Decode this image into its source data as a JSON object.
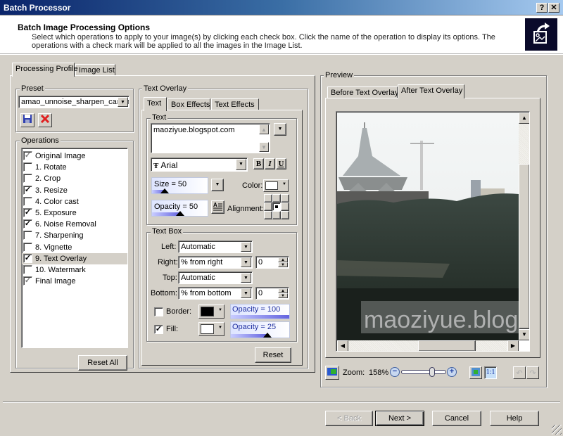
{
  "window": {
    "title": "Batch Processor",
    "help_button": "?",
    "close_button": "✕"
  },
  "header": {
    "title": "Batch Image Processing Options",
    "description": "Select which operations to apply to your image(s) by clicking each check box.  Click the name of the operation to display its options.  The operations with a check mark will be applied to all the images in the Image List."
  },
  "left_tabs": [
    {
      "label": "Processing Profile",
      "active": true
    },
    {
      "label": "Image List",
      "active": false
    }
  ],
  "preset": {
    "group_label": "Preset",
    "selected": "amao_unnoise_sharpen_canon"
  },
  "operations": {
    "group_label": "Operations",
    "items": [
      {
        "label": "Original Image",
        "checked": true,
        "locked": true
      },
      {
        "label": "1. Rotate",
        "checked": false
      },
      {
        "label": "2. Crop",
        "checked": false
      },
      {
        "label": "3. Resize",
        "checked": true
      },
      {
        "label": "4. Color cast",
        "checked": false
      },
      {
        "label": "5. Exposure",
        "checked": true
      },
      {
        "label": "6. Noise Removal",
        "checked": true
      },
      {
        "label": "7. Sharpening",
        "checked": false
      },
      {
        "label": "8. Vignette",
        "checked": false
      },
      {
        "label": "9. Text Overlay",
        "checked": true,
        "selected": true
      },
      {
        "label": "10. Watermark",
        "checked": false
      },
      {
        "label": "Final Image",
        "checked": true,
        "locked": true
      }
    ],
    "reset_all_label": "Reset All"
  },
  "text_overlay": {
    "group_label": "Text Overlay",
    "tabs": [
      {
        "label": "Text",
        "active": true
      },
      {
        "label": "Box Effects",
        "active": false
      },
      {
        "label": "Text Effects",
        "active": false
      }
    ],
    "text_group_label": "Text",
    "text_value": "maoziyue.blogspot.com",
    "font": "Arial",
    "bold_label": "B",
    "italic_label": "I",
    "underline_label": "U",
    "size_label": "Size = 50",
    "size_value": 50,
    "opacity_label": "Opacity = 50",
    "opacity_value": 50,
    "color_label": "Color:",
    "color_value": "#ffffff",
    "alignment_label": "Alignment:",
    "alignment_selected": "center",
    "text_box": {
      "group_label": "Text Box",
      "left_label": "Left:",
      "left_value": "Automatic",
      "right_label": "Right:",
      "right_value": "% from right",
      "right_number": "0",
      "top_label": "Top:",
      "top_value": "Automatic",
      "bottom_label": "Bottom:",
      "bottom_value": "% from bottom",
      "bottom_number": "0",
      "border_label": "Border:",
      "border_checked": false,
      "border_color": "#000000",
      "border_opacity_label": "Opacity = 100",
      "border_opacity_value": 100,
      "fill_label": "Fill:",
      "fill_checked": true,
      "fill_color": "#ffffff",
      "fill_opacity_label": "Opacity = 25",
      "fill_opacity_value": 25
    },
    "reset_label": "Reset"
  },
  "preview": {
    "group_label": "Preview",
    "tabs": [
      {
        "label": "Before Text Overlay",
        "active": false
      },
      {
        "label": "After Text Overlay",
        "active": true
      }
    ],
    "overlay_text": "maoziyue.blog",
    "zoom_label": "Zoom:",
    "zoom_value": "158%",
    "zoom_slider_fraction": 0.72,
    "fit_icon": "fit-to-window-icon",
    "actual_size_label": "1:1"
  },
  "footer": {
    "back_label": "< Back",
    "next_label": "Next >",
    "cancel_label": "Cancel",
    "help_label": "Help"
  }
}
